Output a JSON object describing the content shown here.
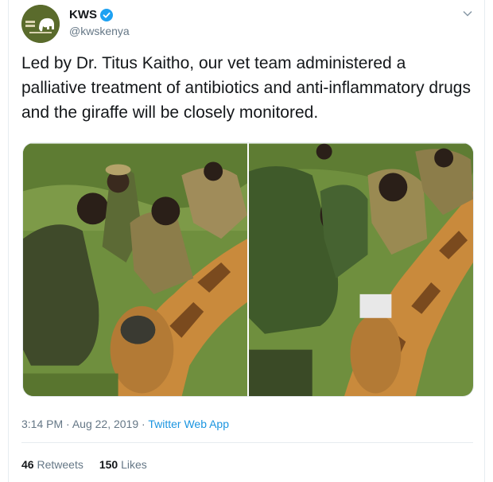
{
  "account": {
    "display_name": "KWS",
    "handle": "@kwskenya",
    "avatar_icon": "kws-elephant-logo",
    "verified_icon": "verified-badge-icon",
    "verified_color": "#1da1f2"
  },
  "tweet": {
    "text": "Led by Dr. Titus Kaitho, our vet team administered a palliative treatment of antibiotics and anti-inflammatory drugs and the giraffe will be closely monitored.",
    "images": [
      "photo-vets-treating-giraffe-left",
      "photo-vets-treating-giraffe-right"
    ]
  },
  "meta": {
    "time": "3:14 PM",
    "date": "Aug 22, 2019",
    "separator": "·",
    "source": "Twitter Web App"
  },
  "stats": {
    "retweets_count": "46",
    "retweets_label": "Retweets",
    "likes_count": "150",
    "likes_label": "Likes"
  },
  "colors": {
    "link": "#1b95e0",
    "muted": "#657786",
    "text": "#14171a"
  }
}
